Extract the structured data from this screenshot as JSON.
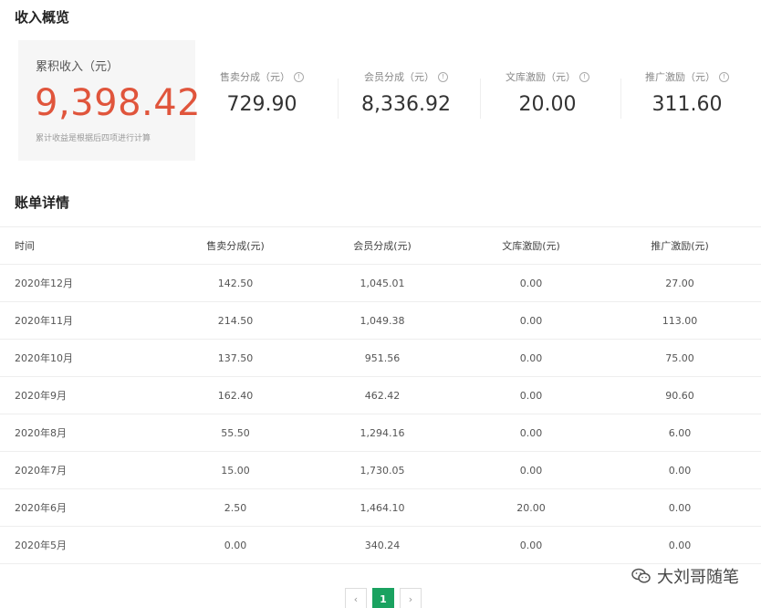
{
  "overview": {
    "title": "收入概览",
    "total": {
      "label": "累积收入（元）",
      "value": "9,398.42",
      "note": "累计收益是根据后四项进行计算"
    },
    "stats": [
      {
        "label": "售卖分成（元）",
        "value": "729.90"
      },
      {
        "label": "会员分成（元）",
        "value": "8,336.92"
      },
      {
        "label": "文库激励（元）",
        "value": "20.00"
      },
      {
        "label": "推广激励（元）",
        "value": "311.60"
      }
    ],
    "info_icon_glyph": "!"
  },
  "bill": {
    "title": "账单详情",
    "headers": [
      "时间",
      "售卖分成(元)",
      "会员分成(元)",
      "文库激励(元)",
      "推广激励(元)"
    ],
    "rows": [
      [
        "2020年12月",
        "142.50",
        "1,045.01",
        "0.00",
        "27.00"
      ],
      [
        "2020年11月",
        "214.50",
        "1,049.38",
        "0.00",
        "113.00"
      ],
      [
        "2020年10月",
        "137.50",
        "951.56",
        "0.00",
        "75.00"
      ],
      [
        "2020年9月",
        "162.40",
        "462.42",
        "0.00",
        "90.60"
      ],
      [
        "2020年8月",
        "55.50",
        "1,294.16",
        "0.00",
        "6.00"
      ],
      [
        "2020年7月",
        "15.00",
        "1,730.05",
        "0.00",
        "0.00"
      ],
      [
        "2020年6月",
        "2.50",
        "1,464.10",
        "20.00",
        "0.00"
      ],
      [
        "2020年5月",
        "0.00",
        "340.24",
        "0.00",
        "0.00"
      ]
    ]
  },
  "pagination": {
    "prev": "‹",
    "current": "1",
    "next": "›"
  },
  "watermark": {
    "text": "大刘哥随笔",
    "icon": "wechat-icon"
  },
  "colors": {
    "total_value": "#e0553c",
    "page_active": "#1aa260"
  }
}
